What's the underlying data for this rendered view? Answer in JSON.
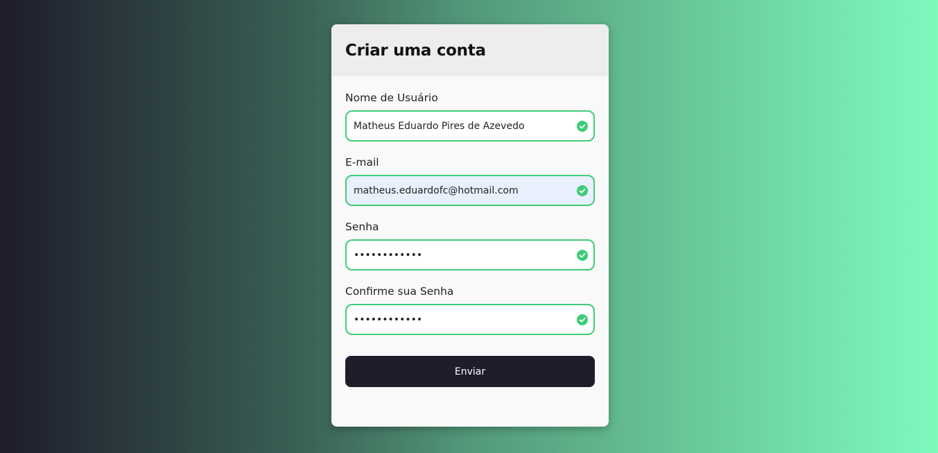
{
  "form": {
    "title": "Criar uma conta",
    "fields": [
      {
        "label": "Nome de Usuário",
        "value": "Matheus Eduardo Pires de Azevedo",
        "type": "text",
        "valid": true
      },
      {
        "label": "E-mail",
        "value": "matheus.eduardofc@hotmail.com",
        "type": "email",
        "valid": true
      },
      {
        "label": "Senha",
        "value": "••••••••••••",
        "type": "password",
        "valid": true
      },
      {
        "label": "Confirme sua Senha",
        "value": "••••••••••••",
        "type": "password",
        "valid": true
      }
    ],
    "submit_label": "Enviar"
  },
  "icons": {
    "valid": "check-circle-icon"
  },
  "colors": {
    "valid_border": "#3fcc78",
    "button_bg": "#1f1c2c",
    "gradient_start": "#1f1c2c",
    "gradient_end": "#7efabd"
  }
}
